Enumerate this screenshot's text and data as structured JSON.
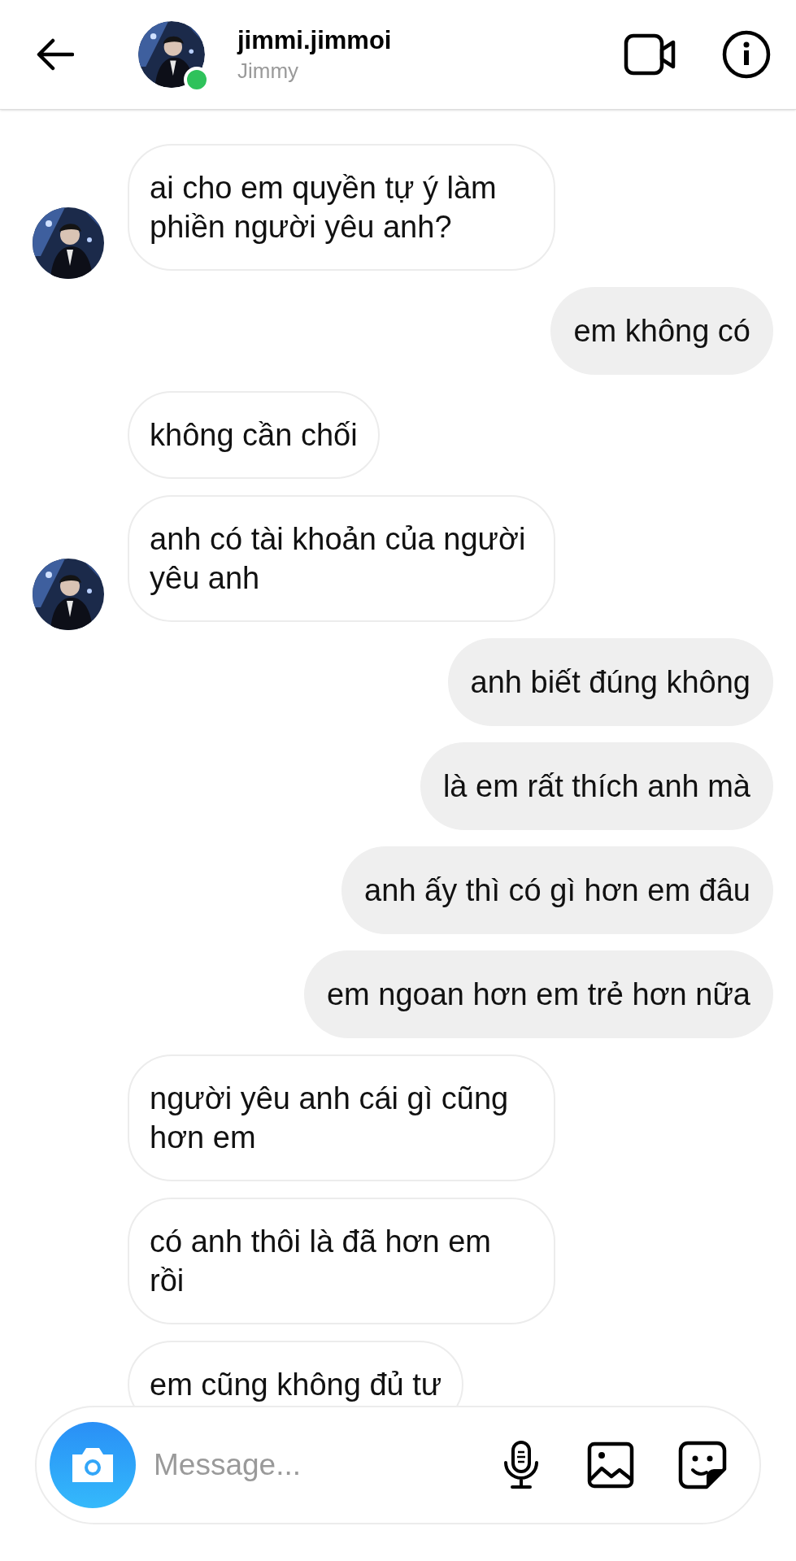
{
  "header": {
    "username": "jimmi.jimmoi",
    "display_name": "Jimmy",
    "online": true
  },
  "messages": [
    {
      "kind": "received",
      "text": "ai cho em quyền tự ý làm phiền người yêu anh?",
      "avatar": true
    },
    {
      "kind": "sent",
      "text": "em không có"
    },
    {
      "kind": "received",
      "text": "không cần chối",
      "avatar": false
    },
    {
      "kind": "received",
      "text": "anh có tài khoản của người yêu anh",
      "avatar": true
    },
    {
      "kind": "sent",
      "text": "anh biết đúng không"
    },
    {
      "kind": "sent",
      "text": "là em rất thích anh mà"
    },
    {
      "kind": "sent",
      "text": "anh ấy thì có gì hơn em đâu"
    },
    {
      "kind": "sent",
      "text": "em ngoan hơn em trẻ hơn nữa"
    },
    {
      "kind": "received",
      "text": "người yêu anh cái gì cũng hơn em",
      "avatar": false
    },
    {
      "kind": "received",
      "text": "có anh thôi là đã hơn em rồi",
      "avatar": false
    },
    {
      "kind": "received",
      "text": "em cũng không đủ tư",
      "avatar": false
    }
  ],
  "composer": {
    "placeholder": "Message..."
  }
}
